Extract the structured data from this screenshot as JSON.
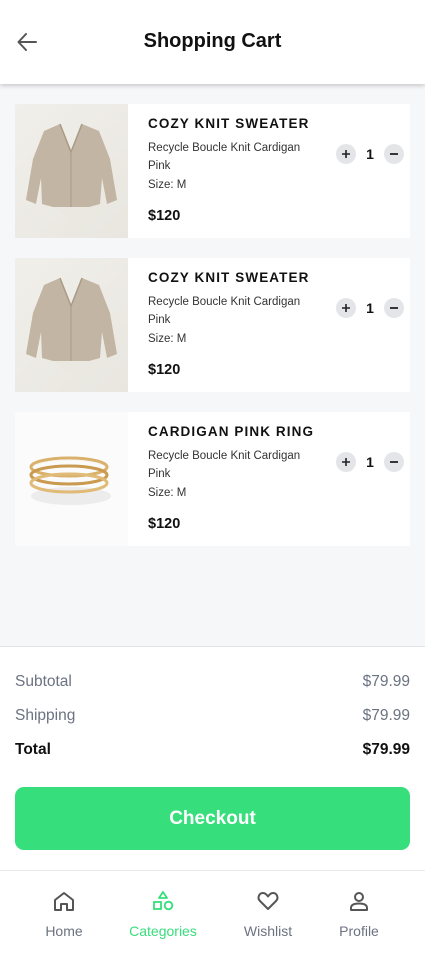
{
  "header": {
    "title": "Shopping Cart",
    "back_icon": "arrow-left-icon"
  },
  "cart": {
    "items": [
      {
        "name": "COZY KNIT SWEATER",
        "description": "Recycle Boucle Knit Cardigan Pink",
        "size": "Size: M",
        "price": "$120",
        "quantity": "1",
        "image": "beige-cardigan"
      },
      {
        "name": "COZY KNIT SWEATER",
        "description": "Recycle Boucle Knit Cardigan Pink",
        "size": "Size: M",
        "price": "$120",
        "quantity": "1",
        "image": "beige-cardigan"
      },
      {
        "name": "CARDIGAN PINK RING",
        "description": "Recycle Boucle Knit Cardigan Pink",
        "size": "Size: M",
        "price": "$120",
        "quantity": "1",
        "image": "gold-ring"
      }
    ]
  },
  "summary": {
    "subtotal_label": "Subtotal",
    "subtotal_value": "$79.99",
    "shipping_label": "Shipping",
    "shipping_value": "$79.99",
    "total_label": "Total",
    "total_value": "$79.99",
    "checkout_label": "Checkout"
  },
  "nav": {
    "items": [
      {
        "label": "Home",
        "icon": "home-icon",
        "active": false
      },
      {
        "label": "Categories",
        "icon": "shapes-icon",
        "active": true
      },
      {
        "label": "Wishlist",
        "icon": "heart-icon",
        "active": false
      },
      {
        "label": "Profile",
        "icon": "user-icon",
        "active": false
      }
    ]
  },
  "colors": {
    "accent": "#37de7c",
    "background": "#f6f7f9",
    "muted_text": "#6b7280"
  }
}
